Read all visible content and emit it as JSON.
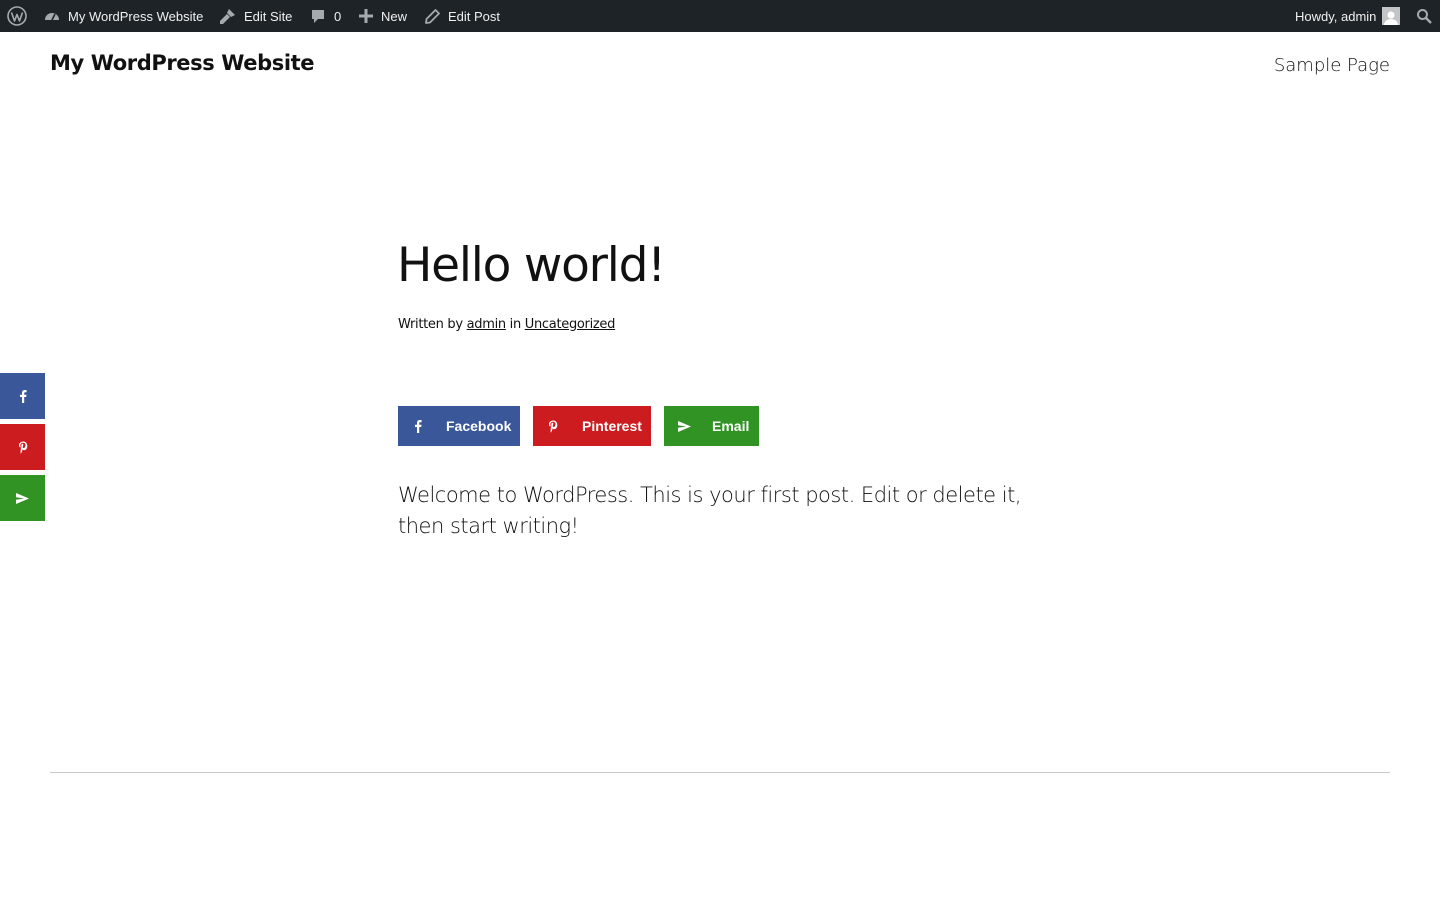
{
  "admin_bar": {
    "site_name": "My WordPress Website",
    "edit_site": "Edit Site",
    "comments_count": "0",
    "new_label": "New",
    "edit_post": "Edit Post",
    "howdy": "Howdy, admin"
  },
  "header": {
    "site_title": "My WordPress Website",
    "nav": [
      "Sample Page"
    ]
  },
  "post": {
    "title": "Hello world!",
    "meta": {
      "written_by": "Written by",
      "author": "admin",
      "in": "in",
      "category": "Uncategorized"
    },
    "body": "Welcome to WordPress. This is your first post. Edit or delete it, then start writing!"
  },
  "share_buttons": [
    {
      "label": "Facebook",
      "color": "#3a579a",
      "icon": "facebook-icon"
    },
    {
      "label": "Pinterest",
      "color": "#cd1c1f",
      "icon": "pinterest-icon"
    },
    {
      "label": "Email",
      "color": "#319324",
      "icon": "email-icon"
    }
  ],
  "floating_share": [
    {
      "icon": "facebook-icon",
      "color": "#3a579a"
    },
    {
      "icon": "pinterest-icon",
      "color": "#cd1c1f"
    },
    {
      "icon": "email-icon",
      "color": "#319324"
    }
  ],
  "colors": {
    "admin_bar_bg": "#1d2327",
    "admin_bar_text": "#f0f0f1",
    "divider": "#c8c8c8"
  }
}
